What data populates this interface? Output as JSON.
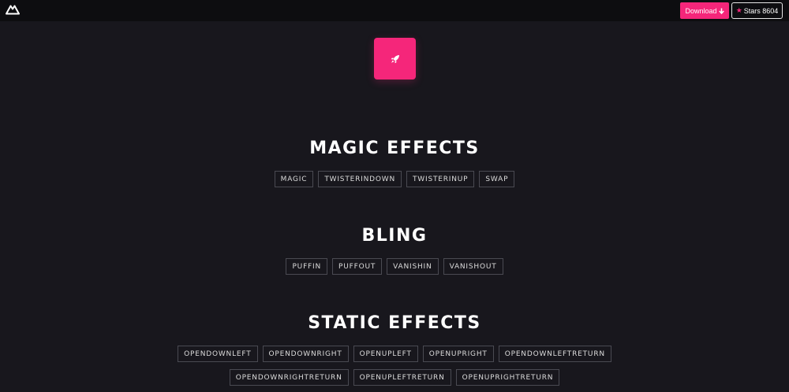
{
  "header": {
    "logo_icon": "logo-mountain-icon",
    "download_label": "Download",
    "download_icon": "arrow-down-icon",
    "stars_label": "Stars 8604",
    "star_icon": "star-icon",
    "accent": "#f5267a"
  },
  "hero": {
    "icon": "rocket-icon"
  },
  "sections": [
    {
      "title": "MAGIC EFFECTS",
      "buttons": [
        "MAGIC",
        "TWISTERINDOWN",
        "TWISTERINUP",
        "SWAP"
      ]
    },
    {
      "title": "BLING",
      "buttons": [
        "PUFFIN",
        "PUFFOUT",
        "VANISHIN",
        "VANISHOUT"
      ]
    },
    {
      "title": "STATIC EFFECTS",
      "buttons": [
        "OPENDOWNLEFT",
        "OPENDOWNRIGHT",
        "OPENUPLEFT",
        "OPENUPRIGHT",
        "OPENDOWNLEFTRETURN",
        "OPENDOWNRIGHTRETURN",
        "OPENUPLEFTRETURN",
        "OPENUPRIGHTRETURN"
      ]
    }
  ]
}
